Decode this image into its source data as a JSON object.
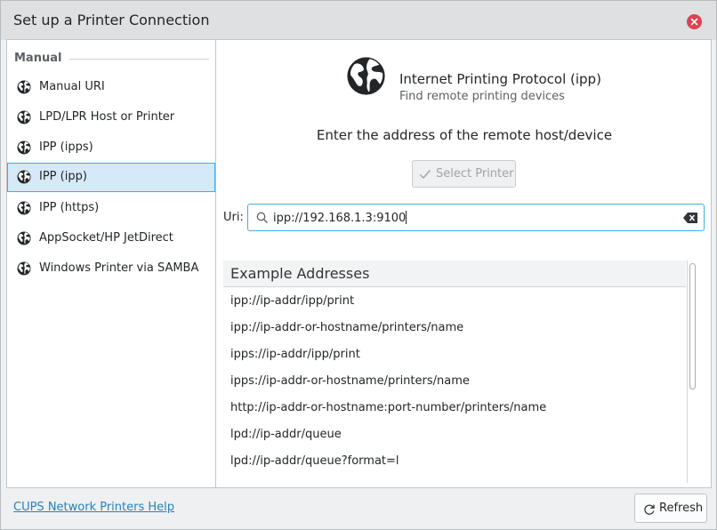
{
  "window": {
    "title": "Set up a Printer Connection",
    "close_icon": "close-icon",
    "accent_color": "#3daee9",
    "close_color": "#da4453"
  },
  "sidebar": {
    "section": "Manual",
    "items": [
      {
        "label": "Manual URI",
        "icon": "globe-icon",
        "selected": false
      },
      {
        "label": "LPD/LPR Host or Printer",
        "icon": "globe-icon",
        "selected": false
      },
      {
        "label": "IPP (ipps)",
        "icon": "globe-icon",
        "selected": false
      },
      {
        "label": "IPP (ipp)",
        "icon": "globe-icon",
        "selected": true
      },
      {
        "label": "IPP (https)",
        "icon": "globe-icon",
        "selected": false
      },
      {
        "label": "AppSocket/HP JetDirect",
        "icon": "globe-icon",
        "selected": false
      },
      {
        "label": "Windows Printer via SAMBA",
        "icon": "globe-icon",
        "selected": false
      }
    ]
  },
  "main": {
    "protocol_title": "Internet Printing Protocol (ipp)",
    "protocol_subtitle": "Find remote printing devices",
    "instruction": "Enter the address of the remote host/device",
    "select_printer_label": "Select Printer",
    "uri_label": "Uri:",
    "uri_value": "ipp://192.168.1.3:9100",
    "examples": {
      "header": "Example Addresses",
      "rows": [
        "ipp://ip-addr/ipp/print",
        "ipp://ip-addr-or-hostname/printers/name",
        "ipps://ip-addr/ipp/print",
        "ipps://ip-addr-or-hostname/printers/name",
        "http://ip-addr-or-hostname:port-number/printers/name",
        "lpd://ip-addr/queue",
        "lpd://ip-addr/queue?format=l"
      ]
    }
  },
  "footer": {
    "help_link": "CUPS Network Printers Help",
    "refresh_label": "Refresh"
  }
}
